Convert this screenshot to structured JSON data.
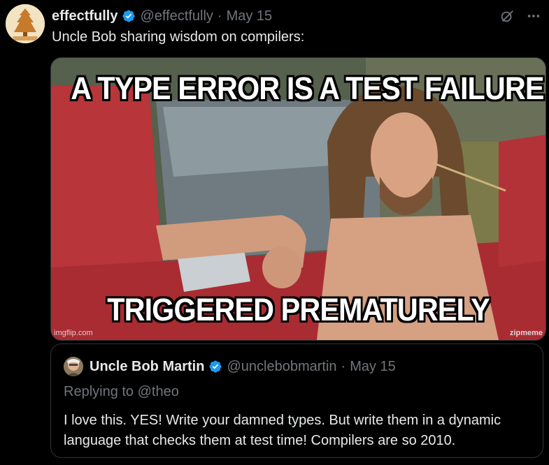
{
  "tweet": {
    "author": {
      "name": "effectfully",
      "handle": "@effectfully",
      "avatar": "avatar-icon"
    },
    "separator": "·",
    "date": "May 15",
    "text": "Uncle Bob sharing wisdom on compilers:",
    "icons": [
      "grok-icon",
      "more-icon"
    ]
  },
  "media": {
    "meme_top": "A TYPE ERROR IS A TEST FAILURE",
    "meme_bottom": "TRIGGERED PREMATURELY",
    "watermark_left": "imgflip.com",
    "watermark_right": "zipmeme"
  },
  "quote": {
    "author": {
      "name": "Uncle Bob Martin",
      "handle": "@unclebobmartin"
    },
    "separator": "·",
    "date": "May 15",
    "replying_to": "Replying to @theo",
    "text": "I love this. YES!  Write your damned types. But write them in a dynamic language that checks them at test time!  Compilers are so 2010."
  },
  "colors": {
    "background": "#000000",
    "text": "#e7e9ea",
    "muted": "#71767b",
    "verified": "#1d9bf0",
    "border": "#2f3336"
  }
}
